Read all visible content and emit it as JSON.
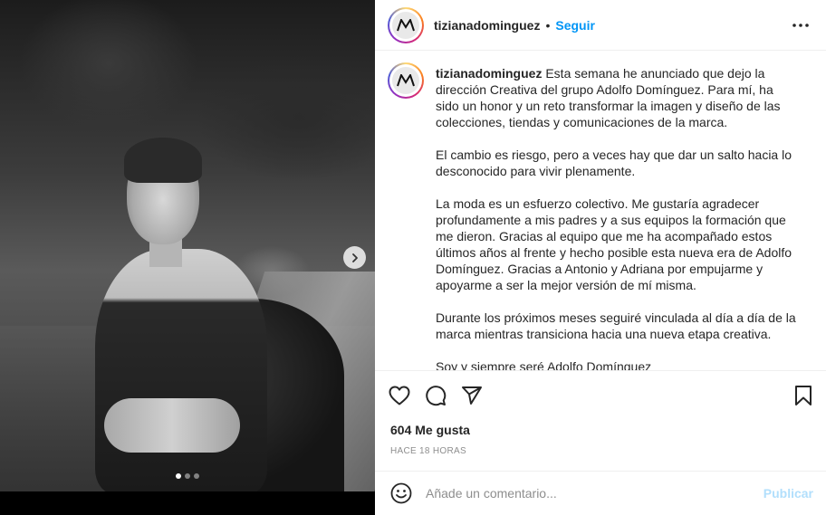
{
  "post": {
    "username": "tizianadominguez",
    "separator": "•",
    "follow_label": "Seguir",
    "more_icon": "more-options-icon"
  },
  "caption": {
    "username": "tizianadominguez",
    "paragraphs": [
      "Esta semana he anunciado que dejo la dirección Creativa del grupo Adolfo Domínguez. Para mí, ha sido un honor y un reto transformar la imagen y diseño de las colecciones, tiendas y comunicaciones de la marca.",
      "El cambio es riesgo, pero a veces hay que dar un salto hacia lo desconocido para vivir plenamente.",
      "La moda es un esfuerzo colectivo. Me gustaría agradecer profundamente a mis padres y a sus equipos la formación que me dieron. Gracias al equipo que me ha acompañado estos últimos años al frente y hecho posible esta nueva era de Adolfo Domínguez. Gracias a Antonio y Adriana por empujarme y apoyarme a ser la mejor versión de mí misma.",
      "Durante los próximos meses seguiré vinculada al día a día de la marca mientras transiciona hacia una nueva etapa creativa.",
      "Soy y siempre seré Adolfo Domínguez"
    ]
  },
  "stats": {
    "likes": "604 Me gusta",
    "time": "HACE 18 HORAS"
  },
  "comment": {
    "placeholder": "Añade un comentario...",
    "publish_label": "Publicar"
  },
  "carousel": {
    "slide_count": 3,
    "active_index": 0
  },
  "colors": {
    "accent": "#0095f6",
    "publish_disabled": "#b2dffc",
    "muted": "#8e8e8e"
  }
}
